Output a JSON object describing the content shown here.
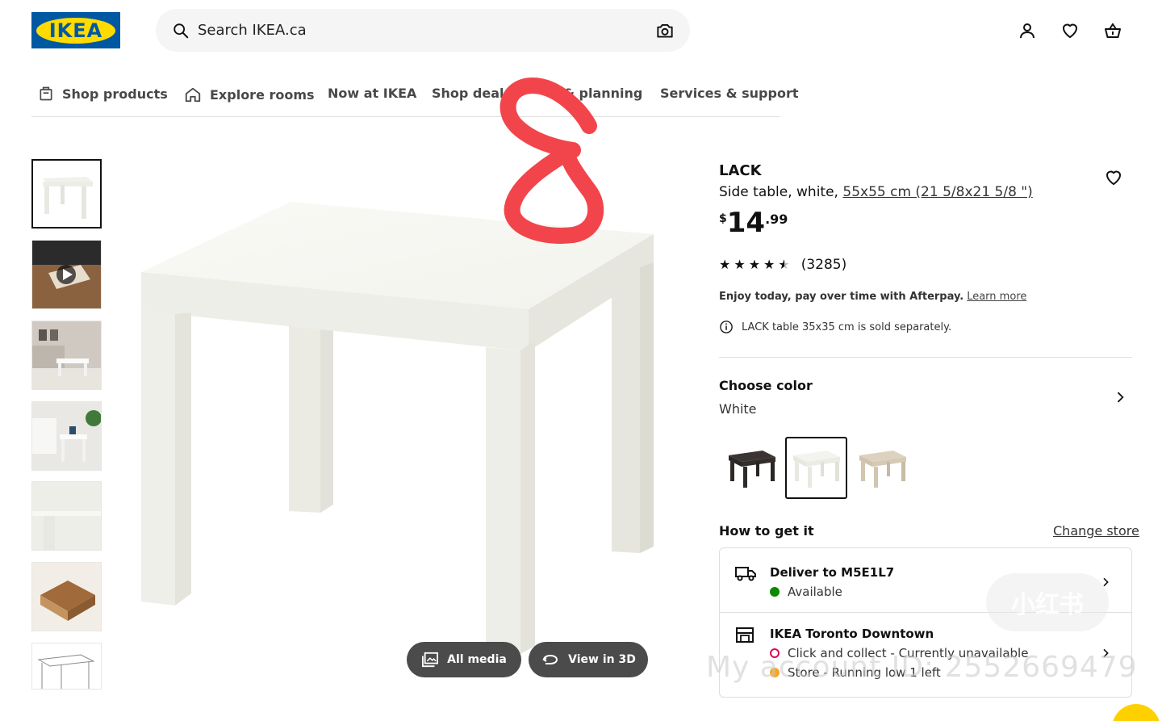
{
  "header": {
    "logo_text": "IKEA",
    "search_placeholder": "Search IKEA.ca",
    "icons": [
      "search-icon",
      "camera-icon",
      "account-icon",
      "heart-icon",
      "cart-icon"
    ]
  },
  "nav": [
    {
      "label": "Shop products",
      "icon": "shop-products-icon"
    },
    {
      "label": "Explore rooms",
      "icon": "house-icon"
    },
    {
      "label": "Now at IKEA"
    },
    {
      "label": "Shop deals"
    },
    {
      "label": "& planning"
    },
    {
      "label": "Services & support"
    }
  ],
  "media": {
    "all_media": "All media",
    "view_3d": "View in 3D"
  },
  "product": {
    "name": "LACK",
    "desc_prefix": "Side table, white, ",
    "measure": "55x55 cm (21 5/8x21 5/8 \")",
    "price_currency": "$",
    "price_int": "14",
    "price_dec": ".99",
    "rating_stars": 4.5,
    "rating_count": "(3285)",
    "afterpay_text": "Enjoy today, pay over time with Afterpay.",
    "afterpay_link": "Learn more",
    "sold_separately": "LACK table 35x35 cm is sold separately."
  },
  "color": {
    "title": "Choose color",
    "value": "White",
    "swatches": [
      "black-brown",
      "white",
      "white-stained-oak"
    ],
    "selected": "white"
  },
  "how_to_get": {
    "title": "How to get it",
    "change_store": "Change store",
    "delivery_title": "Deliver to M5E1L7",
    "delivery_status": "Available",
    "store_title": "IKEA Toronto Downtown",
    "store_status": "Click and collect - Currently unavailable",
    "store_stock": "Store - Running low 1 left"
  },
  "overlay": {
    "watermark": "My account ID: 2552669479",
    "badge": "小红书"
  },
  "colors": {
    "ikea_blue": "#0058a3",
    "ikea_yellow": "#ffdb00",
    "available_green": "#0a8a00",
    "unavailable_red": "#e00751",
    "scribble_red": "#f2454b"
  }
}
